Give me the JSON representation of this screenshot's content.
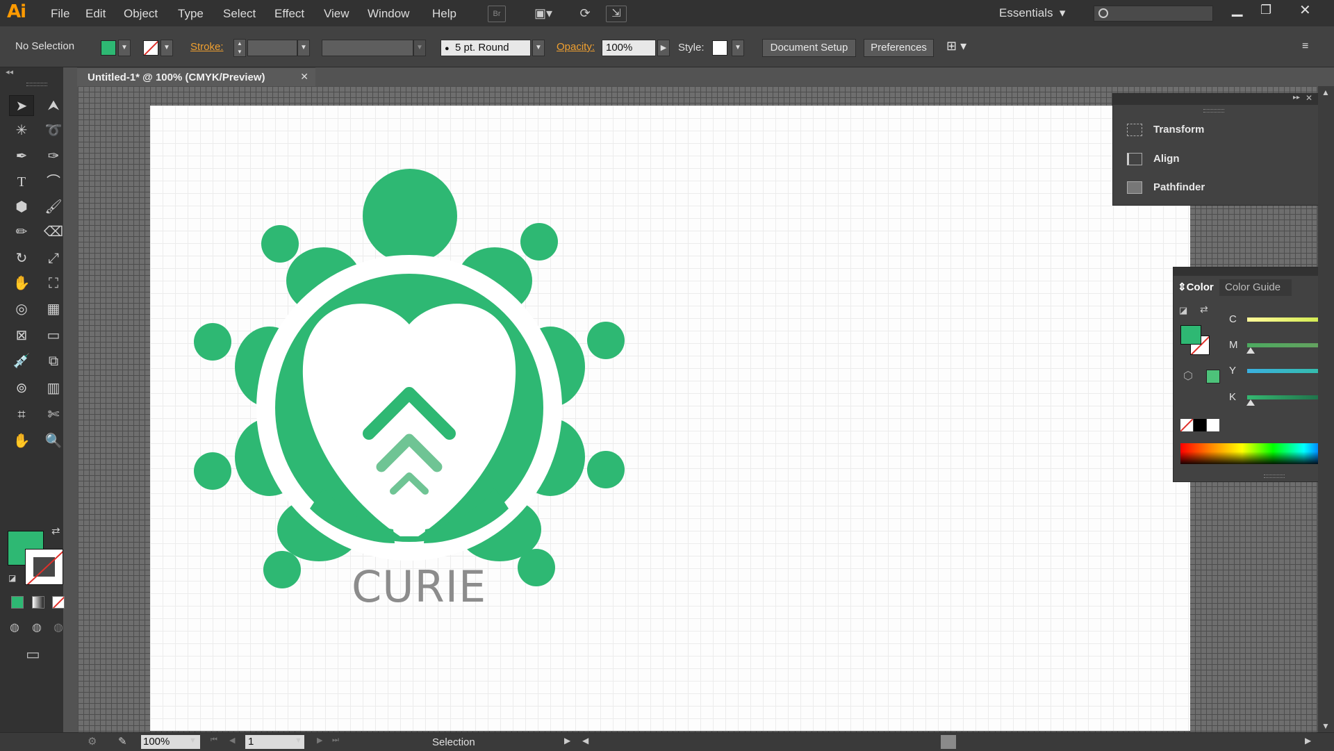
{
  "app": {
    "logo": "Ai",
    "menu": [
      "File",
      "Edit",
      "Object",
      "Type",
      "Select",
      "Effect",
      "View",
      "Window",
      "Help"
    ],
    "bridge_label": "Br",
    "workspace": "Essentials"
  },
  "control_bar": {
    "selection_state": "No Selection",
    "stroke_label": "Stroke:",
    "brush_label": "5 pt. Round",
    "opacity_label": "Opacity:",
    "opacity_value": "100%",
    "style_label": "Style:",
    "document_setup": "Document Setup",
    "preferences": "Preferences"
  },
  "document": {
    "tab_title": "Untitled-1* @ 100% (CMYK/Preview)",
    "logo_text": "CURIE"
  },
  "colors": {
    "fill": "#2eb873",
    "fill_light": "#6fc494",
    "logo_text": "#8c8c8c"
  },
  "tools": [
    "selection-tool",
    "direct-selection-tool",
    "magic-wand-tool",
    "lasso-tool",
    "pen-tool",
    "curvature-tool",
    "type-tool",
    "arc-tool",
    "polygon-tool",
    "paintbrush-tool",
    "pencil-tool",
    "eraser-tool",
    "rotate-tool",
    "scale-tool",
    "puppet-warp-tool",
    "free-transform-tool",
    "shape-builder-tool",
    "perspective-grid-tool",
    "mesh-tool",
    "gradient-tool",
    "eyedropper-tool",
    "blend-tool",
    "symbol-sprayer-tool",
    "column-graph-tool",
    "artboard-tool",
    "slice-tool",
    "hand-tool",
    "zoom-tool"
  ],
  "panels": {
    "transform": "Transform",
    "align": "Align",
    "pathfinder": "Pathfinder",
    "color_tab": "Color",
    "color_guide_tab": "Color Guide",
    "channels": [
      "C",
      "M",
      "Y",
      "K"
    ]
  },
  "status_bar": {
    "zoom": "100%",
    "page": "1",
    "mode": "Selection"
  }
}
